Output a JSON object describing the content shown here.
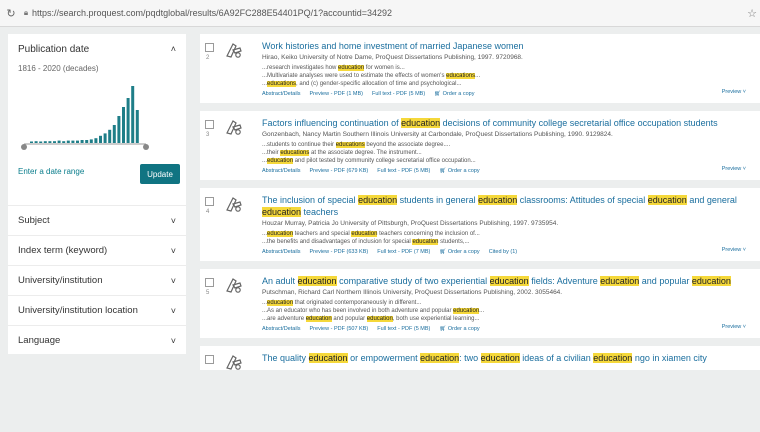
{
  "browser": {
    "url": "https://search.proquest.com/pqdtglobal/results/6A92FC288E54401PQ/1?accountid=34292"
  },
  "sidebar": {
    "pub_date": {
      "title": "Publication date",
      "range": "1816 - 2020 (decades)",
      "enter_label": "Enter a date range",
      "update_label": "Update",
      "bars": [
        0.02,
        0.03,
        0.02,
        0.03,
        0.03,
        0.03,
        0.04,
        0.03,
        0.04,
        0.04,
        0.04,
        0.05,
        0.05,
        0.06,
        0.08,
        0.12,
        0.16,
        0.22,
        0.3,
        0.45,
        0.6,
        0.75,
        0.95,
        0.55
      ]
    },
    "facets": [
      "Subject",
      "Index term (keyword)",
      "University/institution",
      "University/institution location",
      "Language"
    ]
  },
  "results": [
    {
      "number": "2",
      "title": [
        {
          "t": "Work histories and home investment of married Japanese women"
        }
      ],
      "meta": "Hirao, Keiko University of Notre Dame, ProQuest Dissertations Publishing, 1997. 9720968.",
      "snippets": [
        [
          {
            "t": "...research investigates how "
          },
          {
            "t": "education",
            "h": true
          },
          {
            "t": " for women is..."
          }
        ],
        [
          {
            "t": "...Multivariate analyses were used to estimate the effects of women's "
          },
          {
            "t": "educations",
            "h": true
          },
          {
            "t": "..."
          }
        ],
        [
          {
            "t": "..."
          },
          {
            "t": "educations",
            "h": true
          },
          {
            "t": ", and (c) gender-specific allocation of time and psychological..."
          }
        ]
      ],
      "links": [
        "Abstract/Details",
        "Preview - PDF (1 MB)",
        "Full text - PDF (5 MB)",
        "Order a copy"
      ],
      "preview": "Preview"
    },
    {
      "number": "3",
      "title": [
        {
          "t": "Factors influencing continuation of "
        },
        {
          "t": "education",
          "h": true
        },
        {
          "t": " decisions of community college secretarial office occupation students"
        }
      ],
      "meta": "Gonzenbach, Nancy Martin Southern Illinois University at Carbondale, ProQuest Dissertations Publishing, 1990. 9129824.",
      "snippets": [
        [
          {
            "t": "...students to continue their "
          },
          {
            "t": "educations",
            "h": true
          },
          {
            "t": " beyond the associate degree...."
          }
        ],
        [
          {
            "t": "...their "
          },
          {
            "t": "educations",
            "h": true
          },
          {
            "t": " at the associate degree. The instrument..."
          }
        ],
        [
          {
            "t": "..."
          },
          {
            "t": "education",
            "h": true
          },
          {
            "t": " and pilot tested by community college secretarial office occupation..."
          }
        ]
      ],
      "links": [
        "Abstract/Details",
        "Preview - PDF (679 KB)",
        "Full text - PDF (5 MB)",
        "Order a copy"
      ],
      "preview": "Preview"
    },
    {
      "number": "4",
      "title": [
        {
          "t": "The inclusion of special "
        },
        {
          "t": "education",
          "h": true
        },
        {
          "t": " students in general "
        },
        {
          "t": "education",
          "h": true
        },
        {
          "t": " classrooms: Attitudes of special "
        },
        {
          "t": "education",
          "h": true
        },
        {
          "t": " and general "
        },
        {
          "t": "education",
          "h": true
        },
        {
          "t": " teachers"
        }
      ],
      "meta": "Houzar Murray, Patricia Jo University of Pittsburgh, ProQuest Dissertations Publishing, 1997. 9735954.",
      "snippets": [
        [
          {
            "t": "..."
          },
          {
            "t": "education",
            "h": true
          },
          {
            "t": " teachers and special "
          },
          {
            "t": "education",
            "h": true
          },
          {
            "t": " teachers concerning the inclusion of..."
          }
        ],
        [
          {
            "t": "...the benefits and disadvantages of inclusion for special "
          },
          {
            "t": "education",
            "h": true
          },
          {
            "t": " students,..."
          }
        ]
      ],
      "links": [
        "Abstract/Details",
        "Preview - PDF (633 KB)",
        "Full text - PDF (7 MB)",
        "Order a copy",
        "Cited by (1)"
      ],
      "preview": "Preview"
    },
    {
      "number": "5",
      "title": [
        {
          "t": "An adult "
        },
        {
          "t": "education",
          "h": true
        },
        {
          "t": " comparative study of two experiential "
        },
        {
          "t": "education",
          "h": true
        },
        {
          "t": " fields: Adventure "
        },
        {
          "t": "education",
          "h": true
        },
        {
          "t": " and popular "
        },
        {
          "t": "education",
          "h": true
        }
      ],
      "meta": "Putschman, Richard Carl Northern Illinois University, ProQuest Dissertations Publishing, 2002. 3055464.",
      "snippets": [
        [
          {
            "t": "..."
          },
          {
            "t": "education",
            "h": true
          },
          {
            "t": " that originated contemporaneously in different..."
          }
        ],
        [
          {
            "t": "...As an educator who has been involved in both adventure and popular "
          },
          {
            "t": "education",
            "h": true
          },
          {
            "t": "..."
          }
        ],
        [
          {
            "t": "...are adventure "
          },
          {
            "t": "education",
            "h": true
          },
          {
            "t": " and popular "
          },
          {
            "t": "education",
            "h": true
          },
          {
            "t": ", both use experiential learning..."
          }
        ]
      ],
      "links": [
        "Abstract/Details",
        "Preview - PDF (507 KB)",
        "Full text - PDF (5 MB)",
        "Order a copy"
      ],
      "preview": "Preview"
    },
    {
      "number": "",
      "title": [
        {
          "t": "The quality "
        },
        {
          "t": "education",
          "h": true
        },
        {
          "t": " or empowerment "
        },
        {
          "t": "education",
          "h": true
        },
        {
          "t": ": two "
        },
        {
          "t": "education",
          "h": true
        },
        {
          "t": " ideas of a civilian "
        },
        {
          "t": "education",
          "h": true
        },
        {
          "t": " ngo in xiamen city"
        }
      ],
      "meta": "",
      "snippets": [],
      "links": [],
      "preview": ""
    }
  ]
}
